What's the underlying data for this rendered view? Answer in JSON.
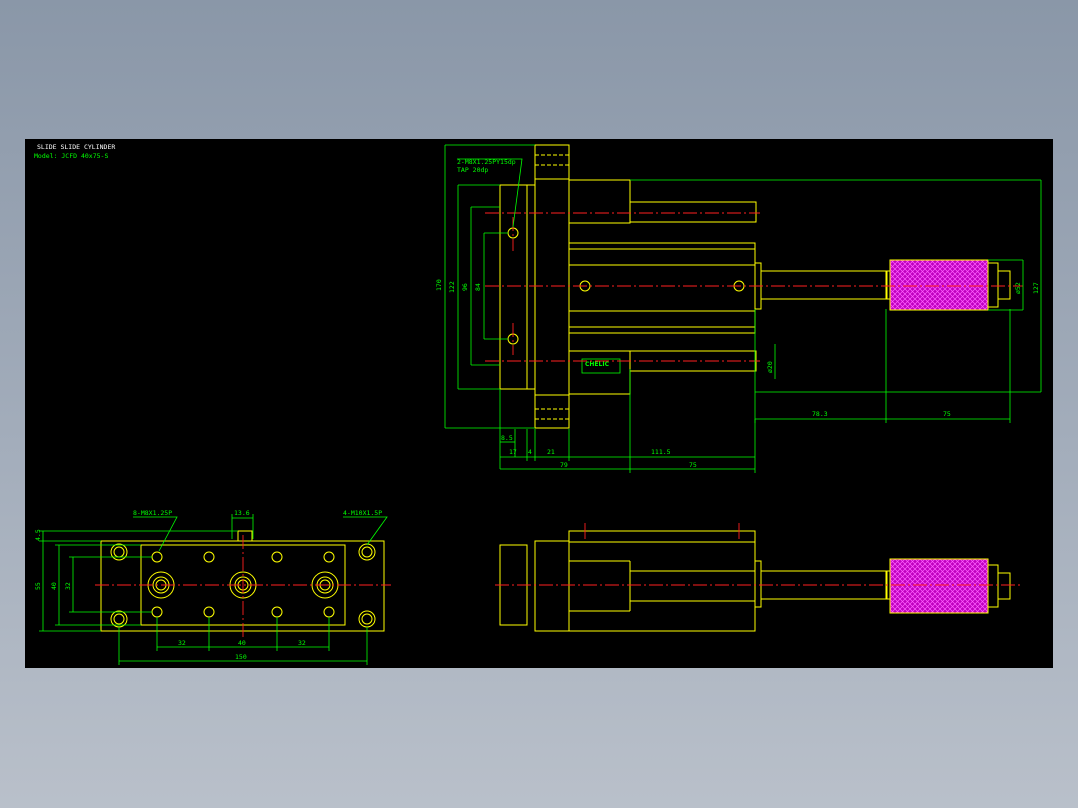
{
  "drawing": {
    "title_line1": "SLIDE SLIDE CYLINDER",
    "title_line2": "Model: JCFD 40x75-S",
    "brand_label": "CHELIC"
  },
  "side_view_callout": {
    "thread_note": "2-M8X1.25PY15dp",
    "sub_note": "TAP 20dp"
  },
  "side_view_dims": {
    "h170": "170",
    "h122": "122",
    "h96": "96",
    "h84": "84",
    "d52": "ø52",
    "d127": "127",
    "d20": "ø20",
    "w78_3": "78.3",
    "w75_rod": "75",
    "w8_5": "8.5",
    "w17": "17",
    "w4": "4",
    "w21": "21",
    "w111_5": "111.5",
    "w79": "79",
    "w75_stroke": "75"
  },
  "front_view_dims": {
    "thread_note_a": "8-M8X1.25P",
    "thread_note_b": "4-M10X1.5P",
    "w13_6": "13.6",
    "h4_5": "4.5",
    "h55": "55",
    "h40": "40",
    "h32": "32",
    "w32a": "32",
    "w40": "40",
    "w32b": "32",
    "w150": "150"
  },
  "colors": {
    "background": "#000000",
    "outline": "#ffff00",
    "dimension": "#00ff00",
    "centerline": "#ff2020",
    "knurl": "#d000d0",
    "window_bg": "#95a1b1"
  }
}
